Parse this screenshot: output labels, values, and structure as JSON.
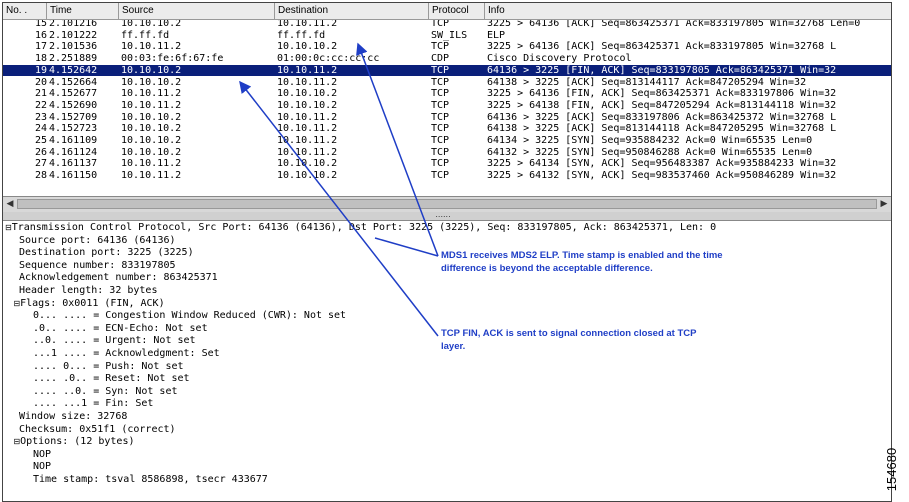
{
  "columns": [
    "No. .",
    "Time",
    "Source",
    "Destination",
    "Protocol",
    "Info"
  ],
  "packets": [
    {
      "no": "15",
      "time": "2.101216",
      "src": "10.10.10.2",
      "dst": "10.10.11.2",
      "proto": "TCP",
      "info": "3225 > 64136 [ACK] Seq=863425371 Ack=833197805 Win=32768 Len=0"
    },
    {
      "no": "16",
      "time": "2.101222",
      "src": "ff.ff.fd",
      "dst": "ff.ff.fd",
      "proto": "SW_ILS",
      "info": "ELP"
    },
    {
      "no": "17",
      "time": "2.101536",
      "src": "10.10.11.2",
      "dst": "10.10.10.2",
      "proto": "TCP",
      "info": "3225 > 64136 [ACK] Seq=863425371 Ack=833197805 Win=32768 L"
    },
    {
      "no": "18",
      "time": "2.251889",
      "src": "00:03:fe:6f:67:fe",
      "dst": "01:00:0c:cc:cc:cc",
      "proto": "CDP",
      "info": "Cisco Discovery Protocol"
    },
    {
      "no": "19",
      "time": "4.152642",
      "src": "10.10.10.2",
      "dst": "10.10.11.2",
      "proto": "TCP",
      "info": "64136 > 3225 [FIN, ACK] Seq=833197805 Ack=863425371 Win=32"
    },
    {
      "no": "20",
      "time": "4.152664",
      "src": "10.10.10.2",
      "dst": "10.10.11.2",
      "proto": "TCP",
      "info": "64138 > 3225 [ACK] Seq=813144117 Ack=847205294 Win=32"
    },
    {
      "no": "21",
      "time": "4.152677",
      "src": "10.10.11.2",
      "dst": "10.10.10.2",
      "proto": "TCP",
      "info": "3225 > 64136 [FIN, ACK] Seq=863425371 Ack=833197806 Win=32"
    },
    {
      "no": "22",
      "time": "4.152690",
      "src": "10.10.11.2",
      "dst": "10.10.10.2",
      "proto": "TCP",
      "info": "3225 > 64138 [FIN, ACK] Seq=847205294 Ack=813144118 Win=32"
    },
    {
      "no": "23",
      "time": "4.152709",
      "src": "10.10.10.2",
      "dst": "10.10.11.2",
      "proto": "TCP",
      "info": "64136 > 3225 [ACK] Seq=833197806 Ack=863425372 Win=32768 L"
    },
    {
      "no": "24",
      "time": "4.152723",
      "src": "10.10.10.2",
      "dst": "10.10.11.2",
      "proto": "TCP",
      "info": "64138 > 3225 [ACK] Seq=813144118 Ack=847205295 Win=32768 L"
    },
    {
      "no": "25",
      "time": "4.161109",
      "src": "10.10.10.2",
      "dst": "10.10.11.2",
      "proto": "TCP",
      "info": "64134 > 3225 [SYN] Seq=935884232 Ack=0 Win=65535 Len=0"
    },
    {
      "no": "26",
      "time": "4.161124",
      "src": "10.10.10.2",
      "dst": "10.10.11.2",
      "proto": "TCP",
      "info": "64132 > 3225 [SYN] Seq=950846288 Ack=0 Win=65535 Len=0"
    },
    {
      "no": "27",
      "time": "4.161137",
      "src": "10.10.11.2",
      "dst": "10.10.10.2",
      "proto": "TCP",
      "info": "3225 > 64134 [SYN, ACK] Seq=956483387 Ack=935884233 Win=32"
    },
    {
      "no": "28",
      "time": "4.161150",
      "src": "10.10.11.2",
      "dst": "10.10.10.2",
      "proto": "TCP",
      "info": "3225 > 64132 [SYN, ACK] Seq=983537460 Ack=950846289 Win=32"
    }
  ],
  "selected_index": 4,
  "splitter_grip": "......",
  "detail_lines": [
    {
      "indent": 0,
      "toggle": "⊟",
      "text": "Transmission Control Protocol, Src Port: 64136 (64136), Dst Port: 3225 (3225), Seq: 833197805, Ack: 863425371, Len: 0"
    },
    {
      "indent": 1,
      "toggle": "",
      "text": "Source port: 64136 (64136)"
    },
    {
      "indent": 1,
      "toggle": "",
      "text": "Destination port: 3225 (3225)"
    },
    {
      "indent": 1,
      "toggle": "",
      "text": "Sequence number: 833197805"
    },
    {
      "indent": 1,
      "toggle": "",
      "text": "Acknowledgement number: 863425371"
    },
    {
      "indent": 1,
      "toggle": "",
      "text": "Header length: 32 bytes"
    },
    {
      "indent": 0.6,
      "toggle": "⊟",
      "text": "Flags: 0x0011 (FIN, ACK)"
    },
    {
      "indent": 2,
      "toggle": "",
      "text": "0... .... = Congestion Window Reduced (CWR): Not set"
    },
    {
      "indent": 2,
      "toggle": "",
      "text": ".0.. .... = ECN-Echo: Not set"
    },
    {
      "indent": 2,
      "toggle": "",
      "text": "..0. .... = Urgent: Not set"
    },
    {
      "indent": 2,
      "toggle": "",
      "text": "...1 .... = Acknowledgment: Set"
    },
    {
      "indent": 2,
      "toggle": "",
      "text": ".... 0... = Push: Not set"
    },
    {
      "indent": 2,
      "toggle": "",
      "text": ".... .0.. = Reset: Not set"
    },
    {
      "indent": 2,
      "toggle": "",
      "text": ".... ..0. = Syn: Not set"
    },
    {
      "indent": 2,
      "toggle": "",
      "text": ".... ...1 = Fin: Set"
    },
    {
      "indent": 1,
      "toggle": "",
      "text": "Window size: 32768"
    },
    {
      "indent": 1,
      "toggle": "",
      "text": "Checksum: 0x51f1 (correct)"
    },
    {
      "indent": 0.6,
      "toggle": "⊟",
      "text": "Options: (12 bytes)"
    },
    {
      "indent": 2,
      "toggle": "",
      "text": "NOP"
    },
    {
      "indent": 2,
      "toggle": "",
      "text": "NOP"
    },
    {
      "indent": 2,
      "toggle": "",
      "text": "Time stamp: tsval 8586898, tsecr 433677"
    }
  ],
  "annotations": {
    "elp_note": "MDS1 receives MDS2 ELP. Time stamp is enabled and the time difference is beyond the acceptable difference.",
    "fin_note": "TCP FIN, ACK is sent to signal connection closed at TCP layer."
  },
  "figure_id": "154680",
  "colors": {
    "selection": "#0a1f7a",
    "annotation": "#1f3ec6"
  }
}
